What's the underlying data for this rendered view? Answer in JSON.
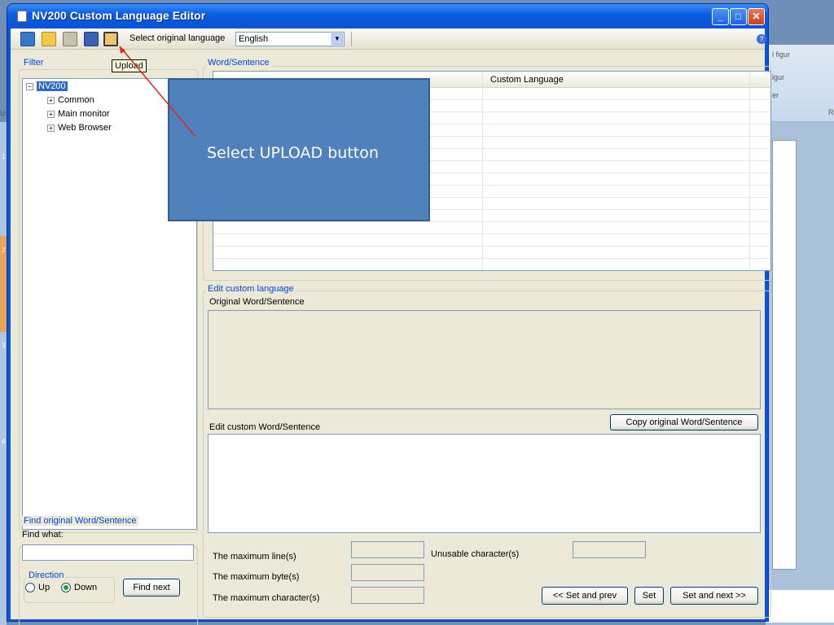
{
  "background_app": {
    "ribbon_items": [
      "l figur",
      "igur",
      "er",
      "R",
      "U"
    ],
    "ruler_marks": [
      "1",
      "2",
      "3",
      "4"
    ]
  },
  "window": {
    "title": "NV200 Custom Language Editor",
    "controls": {
      "minimize": "_",
      "maximize": "□",
      "close": "✕"
    }
  },
  "toolbar": {
    "language_label": "Select original language",
    "language_value": "English",
    "tooltip": "Upload",
    "help": "?"
  },
  "filter": {
    "label": "Filter",
    "root": "NV200",
    "children": [
      "Common",
      "Main monitor",
      "Web Browser"
    ]
  },
  "find": {
    "label": "Find original Word/Sentence",
    "find_what": "Find what:",
    "direction_label": "Direction",
    "up": "Up",
    "down": "Down",
    "find_next": "Find next"
  },
  "word_sentence": {
    "label": "Word/Sentence",
    "col_custom": "Custom Language"
  },
  "edit": {
    "label": "Edit custom language",
    "original_label": "Original Word/Sentence",
    "custom_label": "Edit custom Word/Sentence",
    "copy_button": "Copy original Word/Sentence",
    "max_lines": "The maximum line(s)",
    "max_bytes": "The maximum byte(s)",
    "max_chars": "The maximum character(s)",
    "unusable": "Unusable character(s)",
    "set_prev": "<< Set and prev",
    "set": "Set",
    "set_next": "Set and next >>"
  },
  "annotation": {
    "text": "Select UPLOAD button"
  },
  "colors": {
    "callout": "#4f81bd",
    "arrow": "#e0241b",
    "title_bar": "#0a52d4"
  }
}
